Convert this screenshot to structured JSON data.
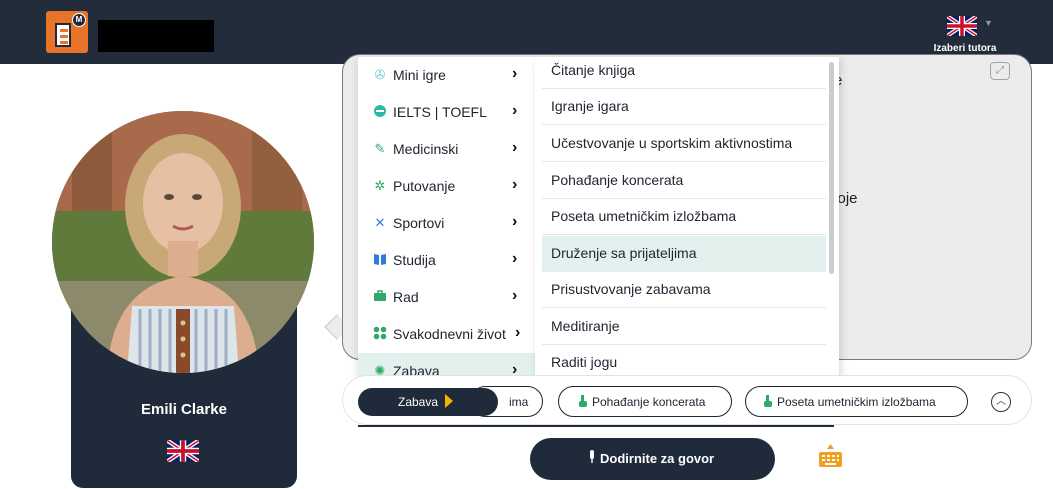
{
  "header": {
    "tutor_button_label": "Izaberi tutora"
  },
  "tutor": {
    "name": "Emili Clarke",
    "flag": "uk-flag-icon"
  },
  "chat": {
    "partial_text_1": "e",
    "partial_text_2": "voje"
  },
  "category_menu": {
    "items": [
      {
        "label": "Mini igre",
        "icon": "gamepad-icon",
        "color": "#6fcfd4"
      },
      {
        "label": "IELTS | TOEFL",
        "icon": "circle-icon",
        "color": "#2fb8a6"
      },
      {
        "label": "Medicinski",
        "icon": "syringe-icon",
        "color": "#2fa86b"
      },
      {
        "label": "Putovanje",
        "icon": "palm-tree-icon",
        "color": "#2fa86b"
      },
      {
        "label": "Sportovi",
        "icon": "sports-icon",
        "color": "#2f7bd8"
      },
      {
        "label": "Studija",
        "icon": "book-icon",
        "color": "#2f7bd8"
      },
      {
        "label": "Rad",
        "icon": "briefcase-icon",
        "color": "#2fa86b"
      },
      {
        "label": "Svakodnevni život",
        "icon": "grid-icon",
        "color": "#2fa86b"
      },
      {
        "label": "Zabava",
        "icon": "pinwheel-icon",
        "color": "#2fa86b"
      }
    ],
    "active_index": 8
  },
  "sub_menu": {
    "items": [
      "Čitanje knjiga",
      "Igranje igara",
      "Učestvovanje u sportskim aktivnostima",
      "Pohađanje koncerata",
      "Poseta umetničkim izložbama",
      "Druženje sa prijateljima",
      "Prisustvovanje zabavama",
      "Meditiranje",
      "Raditi jogu"
    ],
    "active_index": 5
  },
  "suggestions": {
    "topic_label": "Zabava",
    "chips": [
      "ima",
      "Pohađanje koncerata",
      "Poseta umetničkim izložbama"
    ]
  },
  "actions": {
    "talk_label": "Dodirnite za govor"
  },
  "colors": {
    "dark": "#1f2a3a",
    "header": "#232c3a",
    "active_bg": "#e2f0ee",
    "accent_orange": "#e8742a"
  }
}
